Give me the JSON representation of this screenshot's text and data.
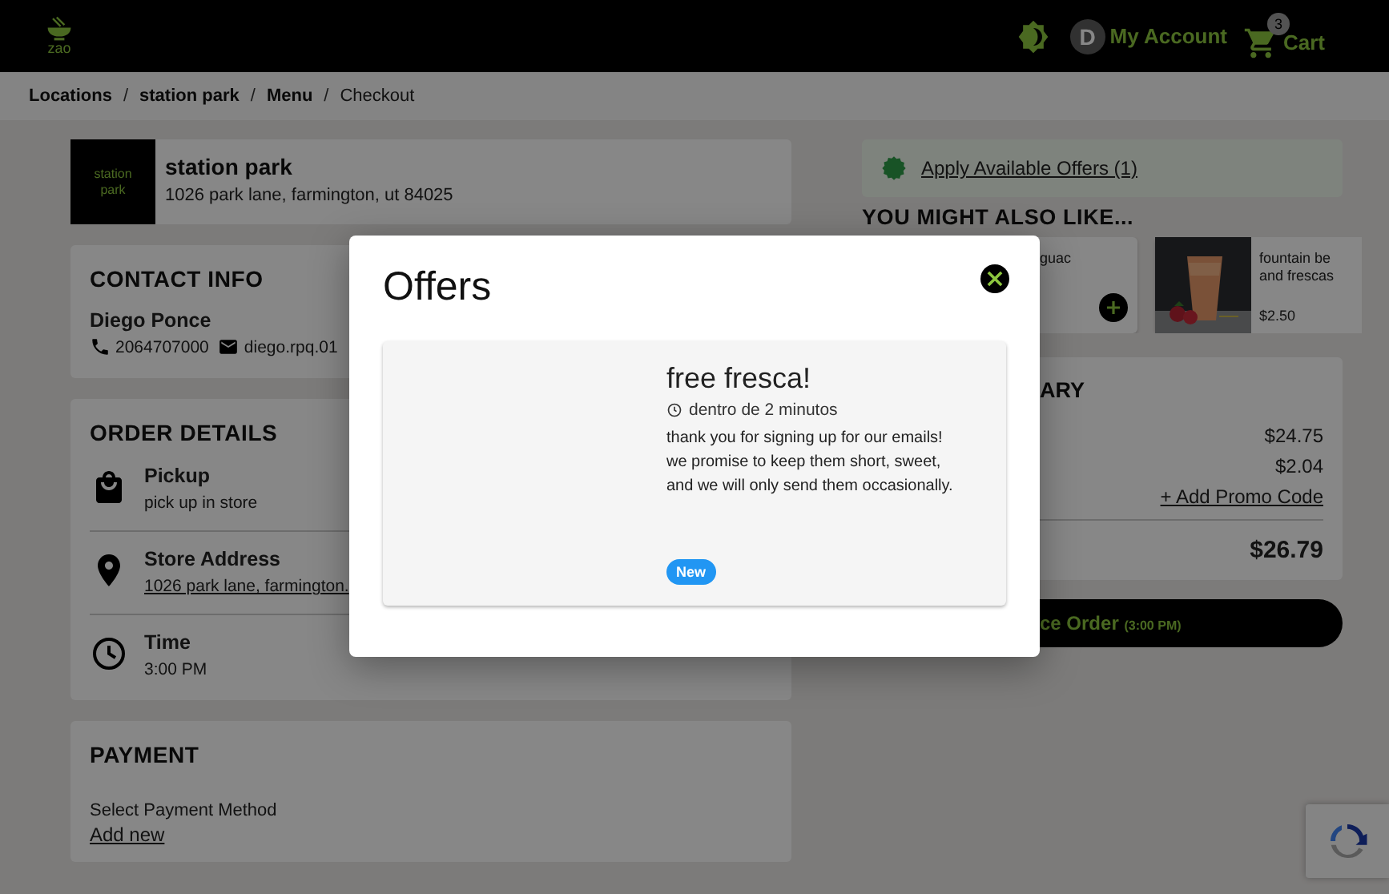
{
  "header": {
    "logo_text": "zao",
    "account": {
      "avatar_letter": "D",
      "label": "My Account"
    },
    "cart": {
      "count": "3",
      "label": "Cart"
    }
  },
  "breadcrumb": [
    {
      "label": "Locations",
      "current": false
    },
    {
      "separator": "/",
      "label": "station park",
      "current": false
    },
    {
      "separator": "/",
      "label": "Menu",
      "current": false
    },
    {
      "separator": "/",
      "label": "Checkout",
      "current": true
    }
  ],
  "store": {
    "logo_text": "station park",
    "name": "station park",
    "address": "1026 park lane, farmington, ut 84025"
  },
  "contact": {
    "title": "CONTACT INFO",
    "name": "Diego Ponce",
    "phone": "2064707000",
    "email": "diego.rpq.01"
  },
  "order_details": {
    "title": "ORDER DETAILS",
    "items": [
      {
        "kind": "pickup",
        "label": "Pickup",
        "value": "pick up in store"
      },
      {
        "kind": "address",
        "label": "Store Address",
        "value": "1026 park lane, farmington."
      },
      {
        "kind": "time",
        "label": "Time",
        "value": "3:00 PM"
      }
    ]
  },
  "payment": {
    "title": "PAYMENT",
    "label": "Select Payment Method",
    "link": "Add new"
  },
  "offers_link": "Apply Available Offers (1)",
  "upsell": {
    "title": "YOU MIGHT ALSO LIKE...",
    "items": [
      {
        "kind": "covered",
        "name": "guac"
      },
      {
        "kind": "picture",
        "name": "fountain be and frescas",
        "price": "$2.50"
      }
    ]
  },
  "summary": {
    "title": "ARY",
    "amounts": [
      "$24.75",
      "$2.04"
    ],
    "promo_link": "+ Add Promo Code",
    "total": "$26.79"
  },
  "place_order": {
    "label": "ce Order",
    "time": "(3:00 PM)"
  },
  "modal": {
    "title": "Offers",
    "offers": [
      {
        "title": "free fresca!",
        "time": "dentro de 2 minutos",
        "description": "thank you for signing up for our emails! we promise to keep them short, sweet, and we will only send them occasionally.",
        "badge": "New"
      }
    ]
  }
}
